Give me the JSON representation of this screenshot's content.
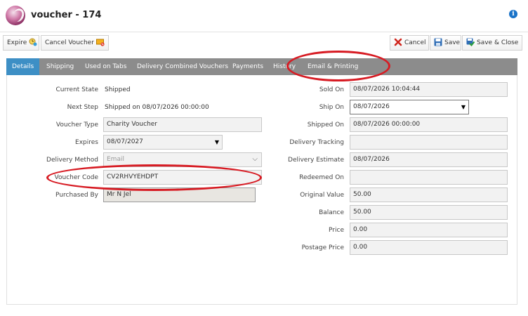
{
  "window": {
    "title": "voucher - 174"
  },
  "icons": {
    "logo": "app-logo",
    "info": "info-icon"
  },
  "toolbar": {
    "expire_label": "Expire",
    "cancel_voucher_label": "Cancel Voucher",
    "cancel_label": "Cancel",
    "save_label": "Save",
    "save_close_label": "Save & Close"
  },
  "tabs": [
    {
      "label": "Details",
      "active": true
    },
    {
      "label": "Shipping"
    },
    {
      "label": "Used on Tabs"
    },
    {
      "label": "Delivery Combined Vouchers"
    },
    {
      "label": "Payments"
    },
    {
      "label": "History"
    },
    {
      "label": "Email & Printing"
    }
  ],
  "left": {
    "current_state": {
      "label": "Current State",
      "value": "Shipped"
    },
    "next_step": {
      "label": "Next Step",
      "value": "Shipped on 08/07/2026 00:00:00"
    },
    "voucher_type": {
      "label": "Voucher Type",
      "value": "Charity Voucher"
    },
    "expires": {
      "label": "Expires",
      "value": "08/07/2027"
    },
    "delivery_method": {
      "label": "Delivery Method",
      "value": "Email"
    },
    "voucher_code": {
      "label": "Voucher Code",
      "value": "CV2RHVYEHDPT"
    },
    "purchased_by": {
      "label": "Purchased By",
      "value": "Mr N Jel"
    }
  },
  "right": {
    "sold_on": {
      "label": "Sold On",
      "value": "08/07/2026 10:04:44"
    },
    "ship_on": {
      "label": "Ship On",
      "value": "08/07/2026"
    },
    "shipped_on": {
      "label": "Shipped On",
      "value": "08/07/2026 00:00:00"
    },
    "delivery_tracking": {
      "label": "Delivery Tracking",
      "value": ""
    },
    "delivery_estimate": {
      "label": "Delivery Estimate",
      "value": "08/07/2026"
    },
    "redeemed_on": {
      "label": "Redeemed On",
      "value": ""
    },
    "original_value": {
      "label": "Original Value",
      "value": "50.00"
    },
    "balance": {
      "label": "Balance",
      "value": "50.00"
    },
    "price": {
      "label": "Price",
      "value": "0.00"
    },
    "postage_price": {
      "label": "Postage Price",
      "value": "0.00"
    }
  },
  "colors": {
    "accent": "#3d8fc5",
    "tabbar": "#8c8c8c",
    "highlight": "#d71b23"
  }
}
